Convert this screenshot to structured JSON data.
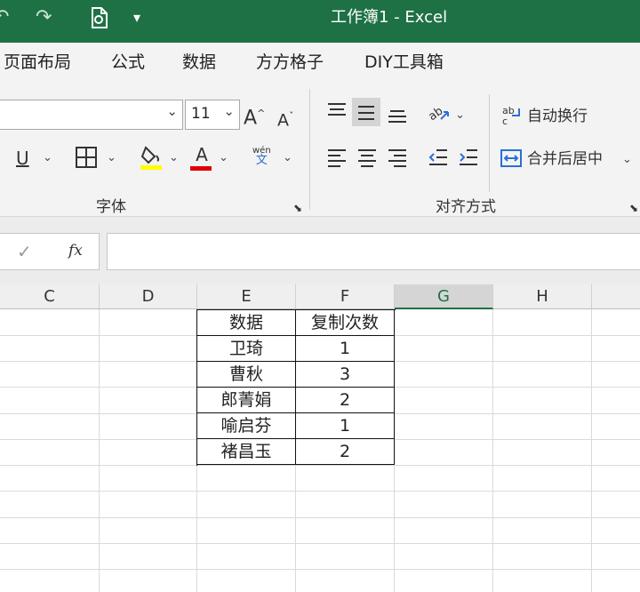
{
  "window": {
    "title": "工作簿1  -  Excel"
  },
  "quick_access": {
    "icons": [
      "undo-icon",
      "redo-icon",
      "print-preview-icon",
      "customize-toolbar-icon"
    ]
  },
  "menu_tabs": [
    "页面布局",
    "公式",
    "数据",
    "方方格子",
    "DIY工具箱"
  ],
  "ribbon": {
    "font_group": {
      "font_name": "",
      "font_size": "11",
      "grow_label": "A",
      "shrink_label": "A",
      "underline_label": "U",
      "font_color_label": "A",
      "phonetic_top": "wén",
      "phonetic_bottom": "文",
      "group_label": "字体",
      "fill_color": "#ffff00",
      "font_color": "#e00000"
    },
    "alignment_group": {
      "wrap_text_label": "自动换行",
      "merge_center_label": "合并后居中",
      "group_label": "对齐方式"
    }
  },
  "formula_bar": {
    "cancel_glyph": "✓",
    "fx_label": "fx",
    "formula_value": ""
  },
  "sheet": {
    "column_headers": [
      "C",
      "D",
      "E",
      "F",
      "G",
      "H"
    ],
    "selected_column": "G",
    "table": {
      "headers": [
        "数据",
        "复制次数"
      ],
      "rows": [
        [
          "卫琦",
          "1"
        ],
        [
          "曹秋",
          "3"
        ],
        [
          "郎菁娟",
          "2"
        ],
        [
          "喻启芬",
          "1"
        ],
        [
          "褚昌玉",
          "2"
        ]
      ]
    }
  },
  "colors": {
    "title_bar": "#1e7145",
    "ribbon_bg": "#f3f3f3"
  }
}
